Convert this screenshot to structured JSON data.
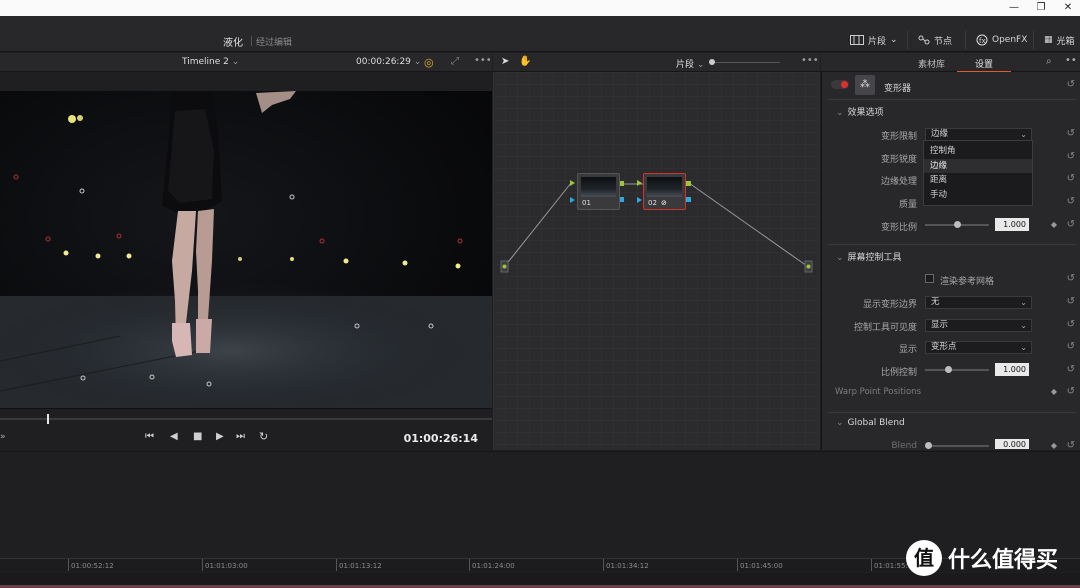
{
  "window": {
    "minimize": "—",
    "restore": "❐",
    "close": "✕"
  },
  "header": {
    "title": "液化",
    "subtitle": "经过编辑",
    "clips_label": "片段",
    "nodes_label": "节点",
    "openfx_label": "OpenFX",
    "lightbox_label": "光箱"
  },
  "viewer": {
    "timeline_name": "Timeline 2",
    "timecode_top": "00:00:26:29",
    "timecode": "01:00:26:14"
  },
  "node_editor": {
    "mode_label": "片段",
    "nodes": [
      {
        "label": "01"
      },
      {
        "label": "02"
      }
    ]
  },
  "panel": {
    "tabs": [
      "素材库",
      "设置"
    ],
    "active_tab": "设置",
    "effect_name": "变形器",
    "sections": {
      "effect_options": "效果选项",
      "onscreen_controls": "屏幕控制工具",
      "global_blend": "Global Blend"
    },
    "rows": {
      "warp_limit": {
        "label": "变形限制",
        "value": "边缘"
      },
      "warp_sharpness": {
        "label": "变形锐度"
      },
      "edge_handling": {
        "label": "边缘处理"
      },
      "quality": {
        "label": "质量"
      },
      "warp_ratio": {
        "label": "变形比例",
        "value": "1.000",
        "level": 0.5
      },
      "render_grid": {
        "label": "渲染参考网格"
      },
      "show_warp_bounds": {
        "label": "显示变形边界",
        "value": "无"
      },
      "control_visibility": {
        "label": "控制工具可见度",
        "value": "显示"
      },
      "display": {
        "label": "显示",
        "value": "变形点"
      },
      "ratio_control": {
        "label": "比例控制",
        "value": "1.000",
        "level": 0.35
      },
      "warp_points": {
        "label": "Warp Point Positions"
      },
      "blend": {
        "label": "Blend",
        "value": "0.000",
        "level": 0.0
      }
    },
    "dropdown_menu": {
      "options": [
        "控制角",
        "边缘",
        "距离",
        "手动"
      ],
      "highlighted": "边缘"
    }
  },
  "timeline": {
    "ticks": [
      "01:00:52:12",
      "01:01:03:00",
      "01:01:13:12",
      "01:01:24:00",
      "01:01:34:12",
      "01:01:45:00",
      "01:01:55:12"
    ]
  },
  "watermark": {
    "badge": "值",
    "text": "什么值得买"
  },
  "colors": {
    "accent": "#e05a2b",
    "selected_node": "#d0342c",
    "bg": "#28282b"
  }
}
